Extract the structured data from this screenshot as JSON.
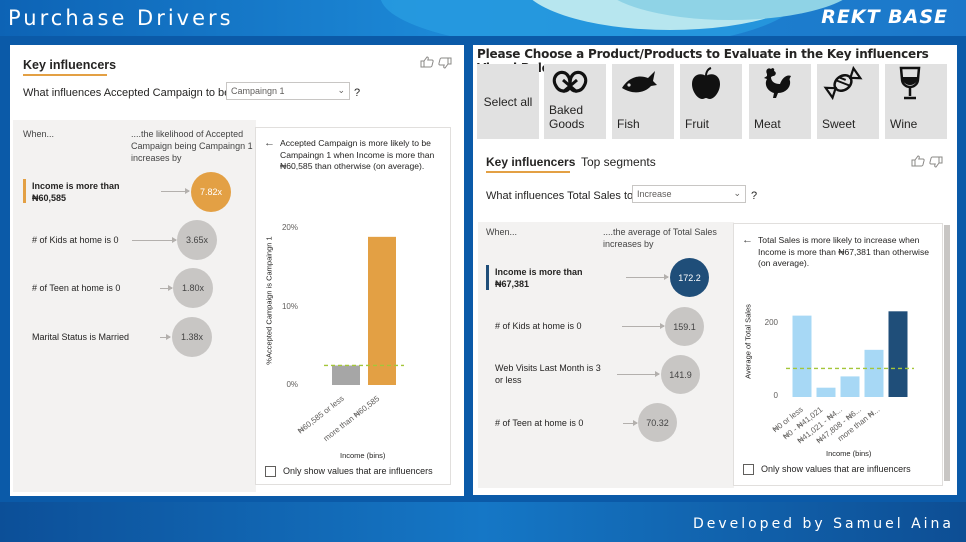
{
  "header": {
    "title": "Purchase Drivers",
    "brand": "REKT BASE"
  },
  "footer": {
    "credit": "Developed by Samuel Aina"
  },
  "left": {
    "title": "Key influencers",
    "question": "What influences Accepted Campaign to be",
    "dropdown_value": "Campaingn 1",
    "qmark": "?",
    "col_when": "When...",
    "col_likelihood": "....the likelihood of Accepted Campaign being Campaingn 1 increases by",
    "influencers": [
      {
        "label": "Income is more than ₦60,585",
        "value": "7.82x",
        "selected": true
      },
      {
        "label": "# of Kids at home is 0",
        "value": "3.65x",
        "selected": false
      },
      {
        "label": "# of Teen at home is 0",
        "value": "1.80x",
        "selected": false
      },
      {
        "label": "Marital Status is Married",
        "value": "1.38x",
        "selected": false
      }
    ],
    "detail": {
      "back": "←",
      "text": "Accepted Campaign is more likely to be Campaingn 1 when Income is more than ₦60,585 than otherwise (on average).",
      "ylabel": "%Accepted Campaign is Campaingn 1",
      "xlabel": "Income (bins)",
      "yticks": [
        "20%",
        "10%",
        "0%"
      ],
      "checkbox_label": "Only show values that are influencers"
    }
  },
  "right": {
    "choose_text": "Please Choose a Product/Products to Evaluate in the Key influencers Visual Below:",
    "products": [
      {
        "label": "Select all",
        "icon": "none"
      },
      {
        "label": "Baked Goods",
        "icon": "pretzel-icon"
      },
      {
        "label": "Fish",
        "icon": "fish-icon"
      },
      {
        "label": "Fruit",
        "icon": "apple-icon"
      },
      {
        "label": "Meat",
        "icon": "rooster-icon"
      },
      {
        "label": "Sweet",
        "icon": "candy-icon"
      },
      {
        "label": "Wine",
        "icon": "wine-glass-icon"
      }
    ],
    "tabs": [
      "Key influencers",
      "Top segments"
    ],
    "question": "What influences Total Sales to",
    "dropdown_value": "Increase",
    "qmark": "?",
    "col_when": "When...",
    "col_avg": "....the average of Total Sales increases by",
    "influencers": [
      {
        "label": "Income is more than ₦67,381",
        "value": "172.2",
        "selected": true
      },
      {
        "label": "# of Kids at home is 0",
        "value": "159.1",
        "selected": false
      },
      {
        "label": "Web Visits Last Month is 3 or less",
        "value": "141.9",
        "selected": false
      },
      {
        "label": "# of Teen at home is 0",
        "value": "70.32",
        "selected": false
      }
    ],
    "detail": {
      "back": "←",
      "text": "Total Sales is more likely to increase when Income is more than ₦67,381 than otherwise (on average).",
      "ylabel": "Average of Total Sales",
      "xlabel": "Income (bins)",
      "yticks": [
        "200",
        "0"
      ],
      "checkbox_label": "Only show values that are influencers"
    }
  },
  "colors": {
    "accent_orange": "#e3a044",
    "accent_navy": "#1f4e79",
    "bar_light_blue": "#a7d8f5",
    "bar_grey": "#a6a6a6"
  },
  "chart_data": [
    {
      "type": "bar",
      "categories": [
        "₦60,585 or less",
        "more than ₦60,585"
      ],
      "values": [
        2.7,
        20.5
      ],
      "ylabel": "%Accepted Campaign is Campaingn 1",
      "xlabel": "Income (bins)",
      "ylim": [
        0,
        22
      ],
      "average_line": 2.7
    },
    {
      "type": "bar",
      "categories": [
        "₦0 or less",
        "₦0 - ₦41,021",
        "₦41,021 - ₦4...",
        "₦47,808 - ₦6...",
        "more than ₦..."
      ],
      "values": [
        245,
        28,
        62,
        142,
        258
      ],
      "ylabel": "Average of Total Sales",
      "xlabel": "Income (bins)",
      "ylim": [
        0,
        280
      ],
      "average_line": 86
    }
  ]
}
